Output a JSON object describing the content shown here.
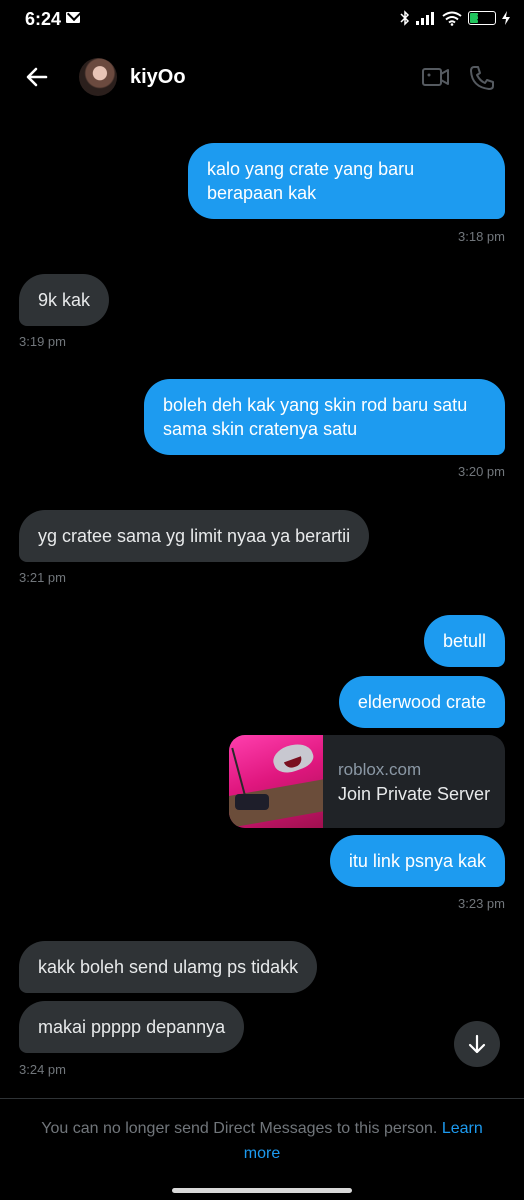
{
  "status_bar": {
    "time": "6:24",
    "battery": "30"
  },
  "header": {
    "contact_name": "kiyOo"
  },
  "messages": [
    {
      "dir": "out",
      "text": "kalo yang crate yang baru berapaan kak",
      "time": "3:18 pm"
    },
    {
      "dir": "in",
      "text": "9k kak",
      "time": "3:19 pm"
    },
    {
      "dir": "out",
      "text": "boleh deh kak yang  skin rod baru satu sama skin cratenya satu",
      "time": "3:20 pm"
    },
    {
      "dir": "in",
      "text": "yg cratee sama yg limit nyaa ya berartii",
      "time": "3:21 pm"
    },
    {
      "dir": "out",
      "text": "betull"
    },
    {
      "dir": "out",
      "text": "elderwood crate"
    },
    {
      "dir": "out",
      "text": "itu link psnya kak",
      "time": "3:23 pm"
    },
    {
      "dir": "in",
      "text": "kakk boleh send ulamg ps tidakk"
    },
    {
      "dir": "in",
      "text": "makai ppppp depannya",
      "time": "3:24 pm"
    }
  ],
  "link_preview": {
    "domain": "roblox.com",
    "title": "Join Private Server"
  },
  "footer": {
    "notice": "You can no longer send Direct Messages to this person.",
    "link": "Learn more"
  },
  "icons": {
    "back": "back-arrow-icon",
    "video": "video-call-icon",
    "call": "phone-call-icon",
    "scroll": "arrow-down-icon"
  },
  "colors": {
    "accent": "#1d9bf0",
    "incoming_bubble": "#2f3336",
    "background": "#000000"
  }
}
